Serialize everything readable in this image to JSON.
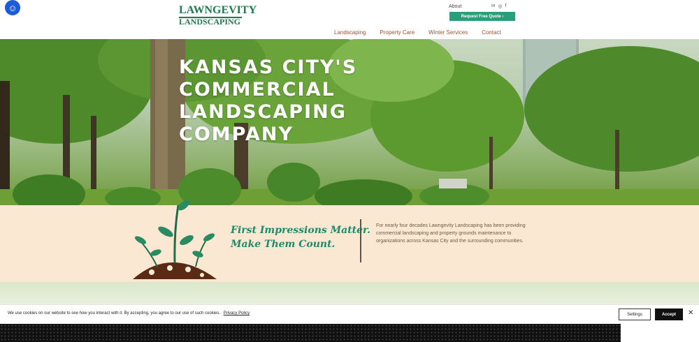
{
  "header": {
    "accessibility_icon": "accessibility-icon",
    "logo": {
      "line1": "LAWNGEVITY",
      "line2": "LANDSCAPING"
    },
    "about_label": "About",
    "social_icons": [
      "linkedin-icon",
      "instagram-icon",
      "facebook-icon"
    ],
    "social_glyphs": [
      "in",
      "◎",
      "f"
    ],
    "quote_button": "Request Free Quote  ›",
    "nav": [
      "Landscaping",
      "Property Care",
      "Winter Services",
      "Contact"
    ]
  },
  "hero": {
    "title_lines": [
      "KANSAS CITY'S",
      "COMMERCIAL",
      "LANDSCAPING",
      "COMPANY"
    ]
  },
  "intro": {
    "tagline_line1": "First Impressions Matter.",
    "tagline_line2": "Make Them Count.",
    "body": "For nearly four decades Lawngevity Landscaping has been providing commercial landscaping and property grounds maintenance to organizations across Kansas City and the surrounding communities."
  },
  "cookie": {
    "text": "We use cookies on our website to see how you interact with it. By accepting, you agree to our use of such cookies.",
    "policy_link": "Privacy Policy",
    "settings_button": "Settings",
    "accept_button": "Accept",
    "close_glyph": "✕"
  },
  "colors": {
    "brand_green": "#1f7a4d",
    "teal_button": "#2a9d7a",
    "nav_text": "#a05230",
    "intro_bg": "#fbe8d3"
  }
}
